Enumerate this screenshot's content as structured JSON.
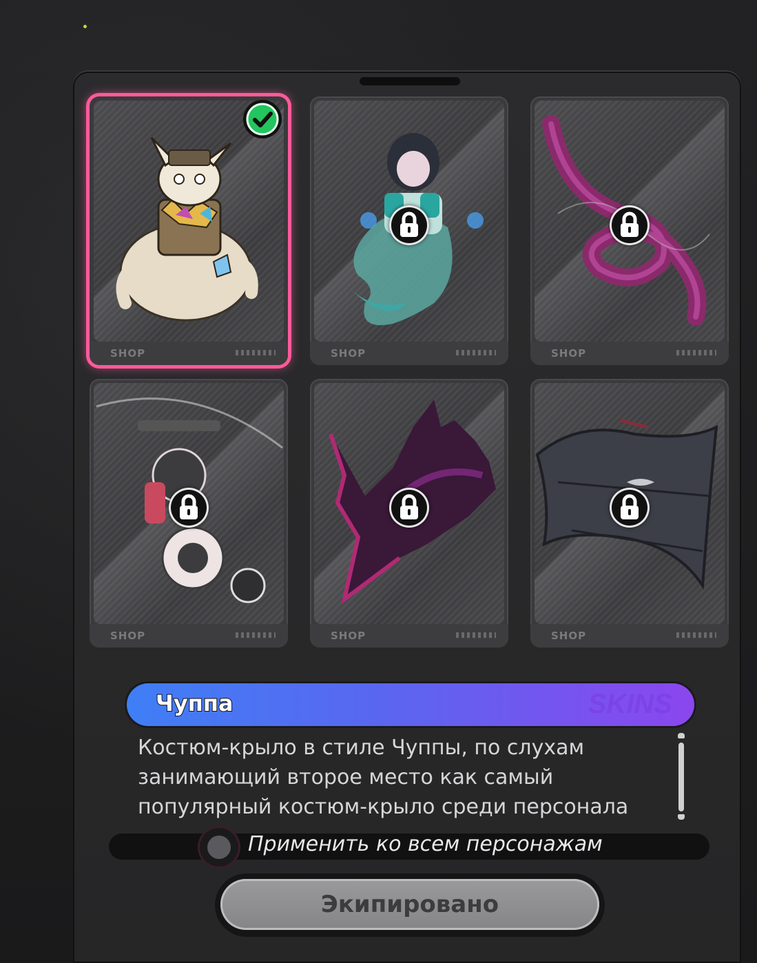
{
  "cards": [
    {
      "item": "chuppa-creature",
      "state": "equipped",
      "footer_logo": "SHOP",
      "icon": "check-icon"
    },
    {
      "item": "ghost-girl",
      "state": "locked",
      "footer_logo": "SHOP",
      "icon": "lock-icon"
    },
    {
      "item": "purple-ribbon",
      "state": "locked",
      "footer_logo": "SHOP",
      "icon": "lock-icon"
    },
    {
      "item": "mech-ninja",
      "state": "locked",
      "footer_logo": "SHOP",
      "icon": "lock-icon"
    },
    {
      "item": "shadow-flame-wing",
      "state": "locked",
      "footer_logo": "SHOP",
      "icon": "lock-icon"
    },
    {
      "item": "bat-glider",
      "state": "locked",
      "footer_logo": "SHOP",
      "icon": "lock-icon"
    }
  ],
  "selected": {
    "name": "Чуппа",
    "tag": "SKINS",
    "description": "Костюм-крыло в стиле Чуппы, по слухам занимающий второе место как самый популярный костюм-крыло среди персонала"
  },
  "apply_all": {
    "label": "Применить ко всем персонажам",
    "checked": false
  },
  "equip_button": {
    "label": "Экипировано"
  },
  "colors": {
    "accent": "#ff5a9a",
    "namebar_start": "#3f7ff5",
    "namebar_end": "#8a47ee",
    "check_green": "#22c55e"
  }
}
